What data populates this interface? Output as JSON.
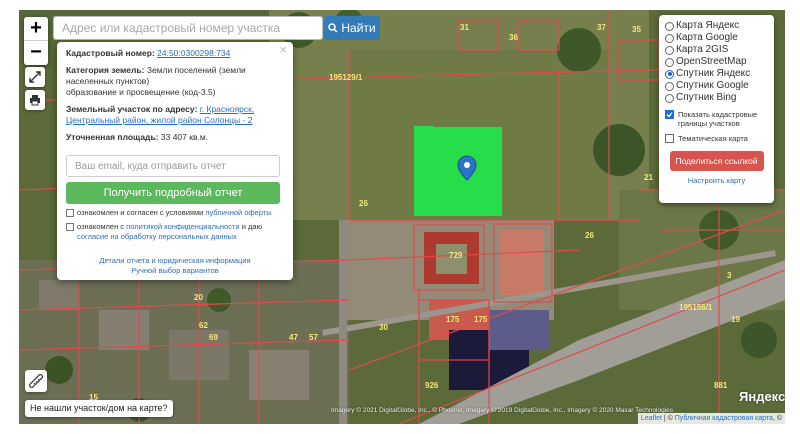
{
  "search": {
    "placeholder": "Адрес или кадастровый номер участка",
    "button_label": "Найти"
  },
  "zoom": {
    "in_label": "+",
    "out_label": "−"
  },
  "popup": {
    "cadastral_label": "Кадастровый номер:",
    "cadastral_number": "24:50:0300298:734",
    "category_label": "Категория земель:",
    "category_value": "Земли поселений (земли населенных пунктов)",
    "usage_value": "образование и просвещение (код-3.5)",
    "address_label": "Земельный участок по адресу:",
    "address_link": "г. Красноярск, Центральный район, жилой район Солонцы - 2",
    "area_label": "Уточненная площадь:",
    "area_value": "33 407 кв.м.",
    "email_placeholder": "Ваш email, куда отправить отчет",
    "report_button": "Получить подробный отчет",
    "agree1_text": "ознакомлен и согласен с условиями",
    "agree1_link": "публичной оферты",
    "agree2_text": "ознакомлен с",
    "agree2_link1": "политикой конфиденциальности",
    "agree2_mid": "и даю",
    "agree2_link2": "согласие на обработку персональных данных",
    "details_link": "Детали отчета и юридическая информация",
    "manual_link": "Ручной выбор вариантов"
  },
  "layers": {
    "items": [
      {
        "label": "Карта Яндекс",
        "selected": false
      },
      {
        "label": "Карта Google",
        "selected": false
      },
      {
        "label": "Карта 2GIS",
        "selected": false
      },
      {
        "label": "OpenStreetMap",
        "selected": false
      },
      {
        "label": "Спутник Яндекс",
        "selected": true
      },
      {
        "label": "Спутник Google",
        "selected": false
      },
      {
        "label": "Спутник Bing",
        "selected": false
      }
    ],
    "show_borders_label": "Показать кадастровые границы участков",
    "show_borders_checked": true,
    "thematic_label": "Тематическая карта",
    "thematic_checked": false,
    "share_button": "Поделиться ссылкой",
    "configure_link": "Настроить карту"
  },
  "map": {
    "plot_labels": [
      "31",
      "36",
      "37",
      "35",
      "195129/1",
      "26",
      "729",
      "26",
      "195156/1",
      "21",
      "19",
      "175",
      "175",
      "926",
      "881",
      "3",
      "62",
      "69",
      "20",
      "15",
      "47",
      "57",
      "30"
    ],
    "highlight_color": "#22e34a",
    "boundary_color": "#e24a4a"
  },
  "bottom": {
    "not_found_button": "Не нашли участок/дом на карте?",
    "copyright": "Imagery © 2021 DigitalGlobe, Inc., © Рhoenix, Imagery © 2019 DigitalGlobe, Inc., Imagery © 2020 Maxar Technologies",
    "yandex_logo": "Яндекс",
    "attribution_leaflet": "Leaflet",
    "attribution_sep": " | © ",
    "attribution_pkk": "Публичная кадастровая карта",
    "attribution_end": ", ©"
  }
}
